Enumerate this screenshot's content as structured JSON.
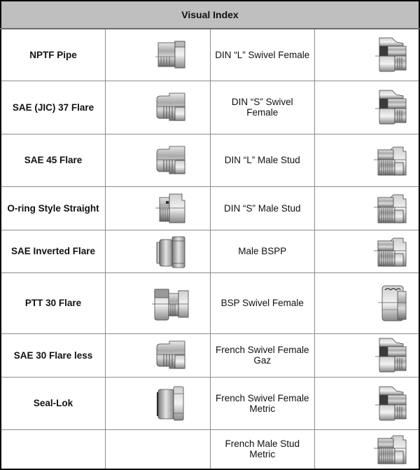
{
  "title": "Visual Index",
  "rows": [
    {
      "left": {
        "label": "NPTF Pipe",
        "icon": "nptf-pipe-fitting-icon",
        "variant": "pipe"
      },
      "right": {
        "label": "DIN “L” Swivel Female",
        "icon": "din-l-swivel-female-fitting-icon",
        "variant": "swivel"
      }
    },
    {
      "left": {
        "label": "SAE (JIC) 37 Flare",
        "icon": "sae-jic-37-flare-fitting-icon",
        "variant": "flare"
      },
      "right": {
        "label": "DIN “S” Swivel Female",
        "icon": "din-s-swivel-female-fitting-icon",
        "variant": "swivel"
      }
    },
    {
      "left": {
        "label": "SAE 45 Flare",
        "icon": "sae-45-flare-fitting-icon",
        "variant": "flare"
      },
      "right": {
        "label": "DIN “L” Male Stud",
        "icon": "din-l-male-stud-fitting-icon",
        "variant": "stud"
      }
    },
    {
      "left": {
        "label": "O-ring Style Straight",
        "icon": "o-ring-straight-fitting-icon",
        "variant": "oring"
      },
      "right": {
        "label": "DIN “S” Male Stud",
        "icon": "din-s-male-stud-fitting-icon",
        "variant": "stud"
      }
    },
    {
      "left": {
        "label": "SAE Inverted Flare",
        "icon": "sae-inverted-flare-fitting-icon",
        "variant": "inverted"
      },
      "right": {
        "label": "Male BSPP",
        "icon": "male-bspp-fitting-icon",
        "variant": "stud"
      }
    },
    {
      "left": {
        "label": "PTT 30 Flare",
        "icon": "ptt-30-flare-fitting-icon",
        "variant": "ptt"
      },
      "right": {
        "label": "BSP Swivel Female",
        "icon": "bsp-swivel-female-fitting-icon",
        "variant": "bspswivel"
      }
    },
    {
      "left": {
        "label": "SAE 30 Flare less",
        "icon": "sae-30-flareless-fitting-icon",
        "variant": "flare"
      },
      "right": {
        "label": "French Swivel Female Gaz",
        "icon": "french-swivel-female-gaz-fitting-icon",
        "variant": "swivel"
      }
    },
    {
      "left": {
        "label": "Seal-Lok",
        "icon": "seal-lok-fitting-icon",
        "variant": "seallok"
      },
      "right": {
        "label": "French Swivel Female Metric",
        "icon": "french-swivel-female-metric-fitting-icon",
        "variant": "swivel"
      }
    },
    {
      "left": {
        "label": "",
        "icon": "",
        "variant": ""
      },
      "right": {
        "label": "French Male Stud Metric",
        "icon": "french-male-stud-metric-fitting-icon",
        "variant": "stud"
      }
    }
  ]
}
